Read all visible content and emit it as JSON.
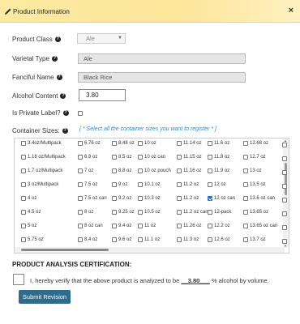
{
  "dialog": {
    "title": "Product Information",
    "close": "×"
  },
  "form": {
    "product_class": {
      "label": "Product Class",
      "value": "Ale"
    },
    "varietal_type": {
      "label": "Varietal Type",
      "value": "Ale"
    },
    "fanciful_name": {
      "label": "Fanciful Name",
      "value": "Black Rice"
    },
    "alcohol_content": {
      "label": "Alcohol Content",
      "value": "3.80"
    },
    "is_private_label": {
      "label": "Is Private Label?",
      "checked": false
    },
    "container_sizes": {
      "label": "Container Sizes:",
      "hint": "[ * Select all the container sizes you want to register * ]",
      "columns": [
        [
          "3.4oz/Multipack",
          "1.18 oz/Multipack",
          "1.7 oz/Multipack",
          "3 oz/Multipack",
          "4 oz",
          "4.5 oz",
          "5 oz",
          "5.75 oz"
        ],
        [
          "6.76 oz",
          "6.8 oz",
          "7 oz",
          "7.5 oz",
          "7.5 oz can",
          "8 oz",
          "8 oz can",
          "8.4 oz"
        ],
        [
          "8.48 oz",
          "8.5 oz",
          "8.8 oz",
          "9 oz",
          "9.2 oz",
          "9.25 oz",
          "9.4 oz",
          "9.6 oz"
        ],
        [
          "10 oz",
          "10 oz can",
          "10 oz pouch",
          "10.1 oz",
          "10.3 oz",
          "10.5 oz",
          "11 oz",
          "11.1 oz"
        ],
        [
          "11.14 oz",
          "11.15 oz",
          "11.16 oz",
          "11.2 oz",
          "11.2 oz",
          "11.2 oz can",
          "11.26 oz",
          "11.3 oz"
        ],
        [
          "11.6 oz",
          "11.8 oz",
          "11.9 oz",
          "12 oz",
          "12 oz can",
          "12-pack",
          "12.2 oz",
          "12.6 oz"
        ],
        [
          "12.68 oz",
          "12.7 oz",
          "13 oz",
          "13.5 oz",
          "13.6 oz can",
          "13.65 oz",
          "13.65 oz can",
          "13.7 oz"
        ]
      ],
      "checked": [
        "12 oz can"
      ]
    }
  },
  "certification": {
    "title": "PRODUCT ANALYSIS CERTIFICATION:",
    "text_before": "I, hereby verify that the above product is analyzed to be",
    "value": "__3.80___",
    "text_after": "% alcohol by volume."
  },
  "submit_label": "Submit Revision",
  "colors": {
    "header_bg": "#fde59a",
    "button_bg": "#2d6c8c",
    "hint": "#2a8bd8",
    "checkbox_checked": "#1f6fd6"
  }
}
